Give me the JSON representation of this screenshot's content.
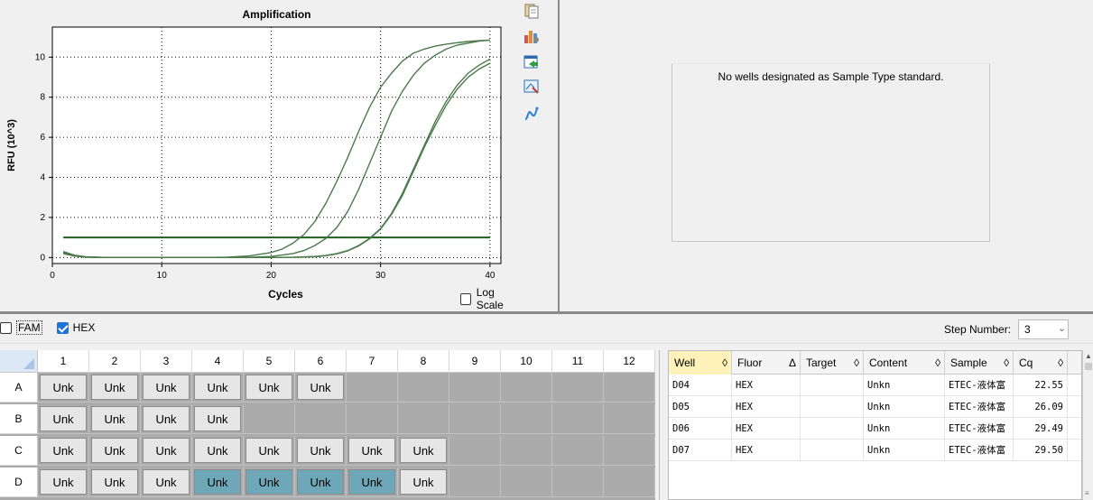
{
  "chart": {
    "toolbar_icons": [
      "copy-icon",
      "chart-settings-icon",
      "export-icon",
      "zoom-icon",
      "curve-fit-icon"
    ],
    "log_scale_label": "Log Scale",
    "log_scale_checked": false
  },
  "chart_data": {
    "type": "line",
    "title": "Amplification",
    "xlabel": "Cycles",
    "ylabel": "RFU (10^3)",
    "xlim": [
      0,
      41
    ],
    "ylim": [
      -0.3,
      11.5
    ],
    "xticks": [
      0,
      10,
      20,
      30,
      40
    ],
    "yticks": [
      0,
      2,
      4,
      6,
      8,
      10
    ],
    "grid": true,
    "threshold": 1.0,
    "series": [
      {
        "well": "D04",
        "cq": 22.55,
        "x": [
          1,
          2,
          3,
          5,
          8,
          10,
          12,
          14,
          16,
          18,
          20,
          21,
          22,
          23,
          24,
          25,
          26,
          27,
          28,
          29,
          30,
          31,
          32,
          33,
          34,
          35,
          36,
          37,
          38,
          39,
          40
        ],
        "y": [
          0.2,
          0.08,
          0.02,
          0,
          0,
          0,
          0,
          0,
          0.02,
          0.08,
          0.25,
          0.42,
          0.72,
          1.15,
          1.8,
          2.7,
          3.8,
          5.0,
          6.3,
          7.5,
          8.5,
          9.2,
          9.8,
          10.2,
          10.4,
          10.55,
          10.65,
          10.72,
          10.78,
          10.82,
          10.85
        ]
      },
      {
        "well": "D05",
        "cq": 26.09,
        "x": [
          1,
          2,
          3,
          5,
          8,
          10,
          12,
          14,
          16,
          18,
          20,
          22,
          23,
          24,
          25,
          26,
          27,
          28,
          29,
          30,
          31,
          32,
          33,
          34,
          35,
          36,
          37,
          38,
          39,
          40
        ],
        "y": [
          0.2,
          0.08,
          0.02,
          0,
          0,
          0,
          0,
          0,
          0,
          0.01,
          0.05,
          0.2,
          0.35,
          0.6,
          0.95,
          1.5,
          2.3,
          3.4,
          4.7,
          6.0,
          7.3,
          8.3,
          9.1,
          9.7,
          10.1,
          10.4,
          10.6,
          10.7,
          10.8,
          10.85
        ]
      },
      {
        "well": "D06",
        "cq": 29.49,
        "x": [
          1,
          2,
          3,
          5,
          8,
          10,
          12,
          14,
          16,
          18,
          20,
          22,
          24,
          25,
          26,
          27,
          28,
          29,
          30,
          31,
          32,
          33,
          34,
          35,
          36,
          37,
          38,
          39,
          40
        ],
        "y": [
          0.25,
          0.1,
          0.03,
          0,
          0,
          0,
          0,
          0,
          0,
          0,
          0,
          0.01,
          0.05,
          0.1,
          0.2,
          0.35,
          0.6,
          0.95,
          1.45,
          2.2,
          3.2,
          4.4,
          5.6,
          6.8,
          7.8,
          8.6,
          9.2,
          9.6,
          9.9
        ]
      },
      {
        "well": "D07",
        "cq": 29.5,
        "x": [
          1,
          2,
          3,
          5,
          8,
          10,
          12,
          14,
          16,
          18,
          20,
          22,
          24,
          25,
          26,
          27,
          28,
          29,
          30,
          31,
          32,
          33,
          34,
          35,
          36,
          37,
          38,
          39,
          40
        ],
        "y": [
          0.3,
          0.12,
          0.04,
          0,
          0,
          0,
          0,
          0,
          0,
          0,
          0,
          0.01,
          0.04,
          0.09,
          0.18,
          0.33,
          0.58,
          0.93,
          1.42,
          2.15,
          3.1,
          4.3,
          5.5,
          6.6,
          7.6,
          8.4,
          9.0,
          9.4,
          9.7
        ]
      }
    ]
  },
  "standard_curve": {
    "message": "No wells designated as Sample Type standard."
  },
  "fluors": [
    {
      "label": "FAM",
      "checked": false
    },
    {
      "label": "HEX",
      "checked": true
    }
  ],
  "step": {
    "label": "Step Number:",
    "value": "3"
  },
  "plate": {
    "columns": [
      "1",
      "2",
      "3",
      "4",
      "5",
      "6",
      "7",
      "8",
      "9",
      "10",
      "11",
      "12"
    ],
    "rows": [
      {
        "label": "A",
        "wells": [
          "Unk",
          "Unk",
          "Unk",
          "Unk",
          "Unk",
          "Unk",
          "",
          "",
          "",
          "",
          "",
          ""
        ],
        "selected": []
      },
      {
        "label": "B",
        "wells": [
          "Unk",
          "Unk",
          "Unk",
          "Unk",
          "",
          "",
          "",
          "",
          "",
          "",
          "",
          ""
        ],
        "selected": []
      },
      {
        "label": "C",
        "wells": [
          "Unk",
          "Unk",
          "Unk",
          "Unk",
          "Unk",
          "Unk",
          "Unk",
          "Unk",
          "",
          "",
          "",
          ""
        ],
        "selected": []
      },
      {
        "label": "D",
        "wells": [
          "Unk",
          "Unk",
          "Unk",
          "Unk",
          "Unk",
          "Unk",
          "Unk",
          "Unk",
          "",
          "",
          "",
          ""
        ],
        "selected": [
          3,
          4,
          5,
          6
        ]
      }
    ]
  },
  "results": {
    "headers": [
      {
        "label": "Well",
        "sort": "◊",
        "active": true
      },
      {
        "label": "Fluor",
        "sort": "Δ",
        "active": false
      },
      {
        "label": "Target",
        "sort": "◊",
        "active": false
      },
      {
        "label": "Content",
        "sort": "◊",
        "active": false
      },
      {
        "label": "Sample",
        "sort": "◊",
        "active": false
      },
      {
        "label": "Cq",
        "sort": "◊",
        "active": false
      }
    ],
    "rows": [
      {
        "well": "D04",
        "fluor": "HEX",
        "target": "",
        "content": "Unkn",
        "sample": "ETEC-液体富",
        "cq": "22.55"
      },
      {
        "well": "D05",
        "fluor": "HEX",
        "target": "",
        "content": "Unkn",
        "sample": "ETEC-液体富",
        "cq": "26.09"
      },
      {
        "well": "D06",
        "fluor": "HEX",
        "target": "",
        "content": "Unkn",
        "sample": "ETEC-液体富",
        "cq": "29.49"
      },
      {
        "well": "D07",
        "fluor": "HEX",
        "target": "",
        "content": "Unkn",
        "sample": "ETEC-液体富",
        "cq": "29.50"
      }
    ]
  },
  "colors": {
    "curve": "#4a7a4a",
    "threshold": "#1f5f1f",
    "selected_well": "#6ea8b8",
    "checkbox_checked": "#1e73d8"
  }
}
